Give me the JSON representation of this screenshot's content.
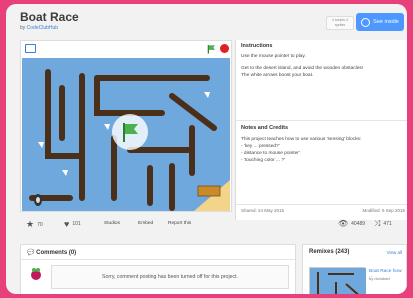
{
  "project": {
    "title": "Boat Race",
    "byline_prefix": "by",
    "author": "CodeClubHub",
    "remix_note": "4 scripts\n4 sprites",
    "see_inside_label": "See inside"
  },
  "instructions": {
    "heading": "Instructions",
    "line1": "Use the mouse pointer to play.",
    "line2": "Get to the desert island, and avoid the wooden obstacles!",
    "line3": "The white arrows boost your boat."
  },
  "notes": {
    "heading": "Notes and Credits",
    "line1": "This project teaches how to use various 'sensing' blocks:",
    "line2": "- 'key ... pressed?'",
    "line3": "- distance to mouse pointer'",
    "line4": "- 'touching color ... ?'"
  },
  "dates": {
    "shared": "Shared: 24 May 2015",
    "modified": "Modified: 6 Sep 2016"
  },
  "stats": {
    "stars": "70",
    "loves": "101",
    "studios_label": "Studios",
    "embed_label": "Embed",
    "report_label": "Report this",
    "views": "40489",
    "remixes_count": "471"
  },
  "comments": {
    "heading": "Comments (0)",
    "notice": "Sorry, comment posting has been turned off for this project."
  },
  "remixes": {
    "heading": "Remixes (243)",
    "view_all": "View all",
    "item_title": "Boat Race how ...",
    "item_by": "by rbclubart"
  },
  "colors": {
    "accent": "#4d97ff",
    "background": "#e8407a",
    "water": "#6fa8dc",
    "log": "#4a2f1a",
    "stop": "#e02020"
  }
}
